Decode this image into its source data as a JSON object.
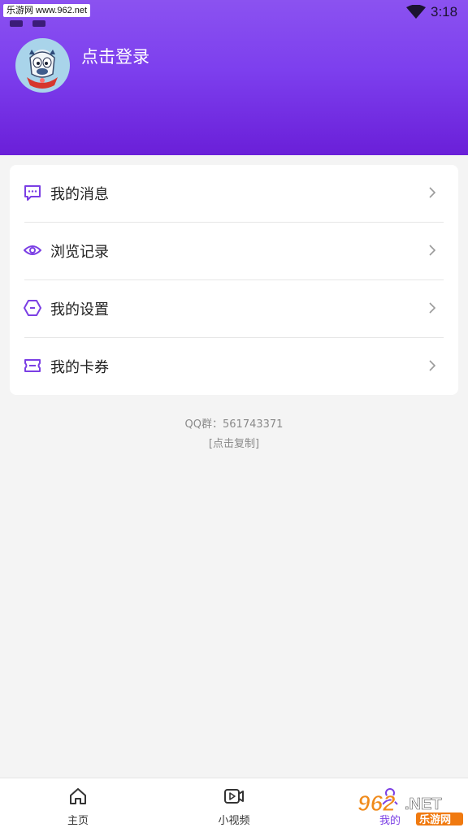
{
  "status_bar": {
    "watermark": "乐游网 www.962.net",
    "time": "3:18"
  },
  "profile": {
    "login_label": "点击登录"
  },
  "menu": {
    "items": [
      {
        "label": "我的消息",
        "icon": "message-icon"
      },
      {
        "label": "浏览记录",
        "icon": "eye-icon"
      },
      {
        "label": "我的设置",
        "icon": "settings-hexagon-icon"
      },
      {
        "label": "我的卡券",
        "icon": "ticket-icon"
      }
    ]
  },
  "footer_info": {
    "qq_group": "QQ群：561743371",
    "copy_hint": "[点击复制]"
  },
  "tabbar": {
    "tabs": [
      {
        "label": "主页",
        "icon": "home-icon"
      },
      {
        "label": "小视频",
        "icon": "video-icon"
      },
      {
        "label": "我的",
        "icon": "user-icon"
      }
    ]
  },
  "watermark_bottom": {
    "text": "962.NET 乐游网"
  },
  "colors": {
    "accent": "#7b3fe4",
    "header_top": "#8b52f0",
    "header_bottom": "#6a1fd8",
    "background": "#f4f4f4"
  }
}
